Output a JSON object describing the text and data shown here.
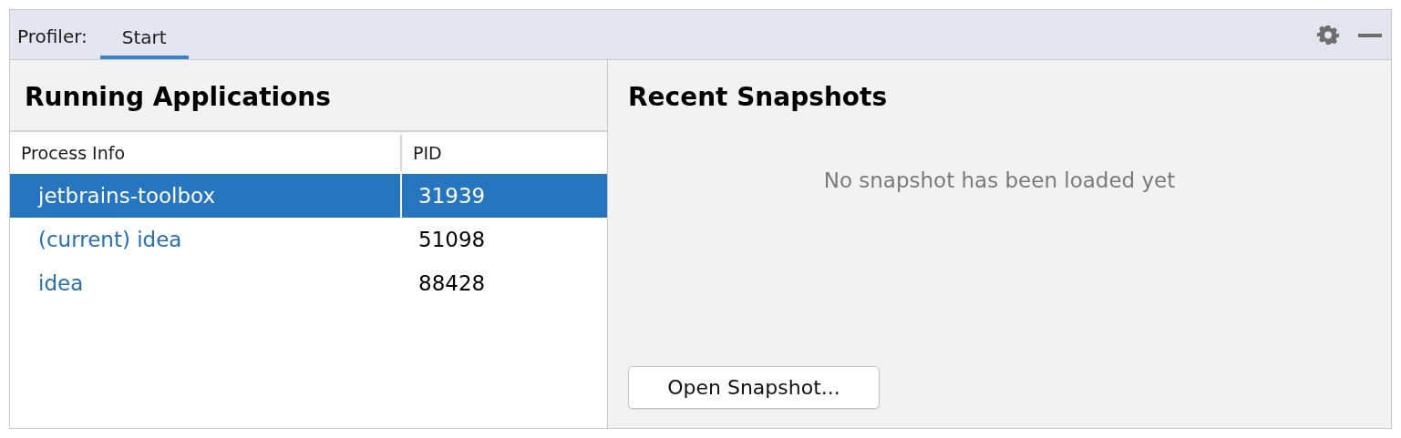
{
  "toolbar": {
    "label": "Profiler:",
    "tabs": [
      {
        "label": "Start",
        "selected": true
      }
    ]
  },
  "running": {
    "title": "Running Applications",
    "columns": [
      "Process Info",
      "PID"
    ],
    "rows": [
      {
        "name": "jetbrains-toolbox",
        "pid": "31939",
        "selected": true
      },
      {
        "name": "(current) idea",
        "pid": "51098",
        "selected": false
      },
      {
        "name": "idea",
        "pid": "88428",
        "selected": false
      }
    ]
  },
  "snapshots": {
    "title": "Recent Snapshots",
    "empty_text": "No snapshot has been loaded yet",
    "button": "Open Snapshot..."
  }
}
